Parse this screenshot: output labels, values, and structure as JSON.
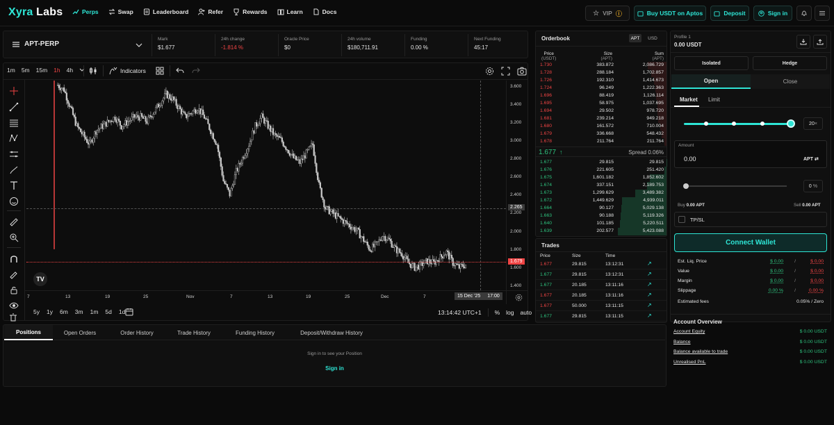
{
  "nav": {
    "logo_a": "Xyra",
    "logo_b": " Labs",
    "links": [
      "Perps",
      "Swap",
      "Leaderboard",
      "Refer",
      "Rewards",
      "Learn",
      "Docs"
    ],
    "vip": "VIP",
    "buy": "Buy USDT on Aptos",
    "deposit": "Deposit",
    "signin": "Sign in"
  },
  "market": {
    "symbol": "APT-PERP",
    "stats": [
      {
        "label": "Mark",
        "value": "$1.677"
      },
      {
        "label": "24h change",
        "value": "-1.814 %"
      },
      {
        "label": "Oracle Price",
        "value": "$0"
      },
      {
        "label": "24h volume",
        "value": "$180,711.91"
      },
      {
        "label": "Funding",
        "value": "0.00 %"
      },
      {
        "label": "Next Funding",
        "value": "45:17"
      }
    ]
  },
  "chart": {
    "timeframes": [
      "1m",
      "5m",
      "15m",
      "1h",
      "4h"
    ],
    "active_tf": "1h",
    "indicators": "Indicators",
    "y_ticks": [
      "3.600",
      "3.400",
      "3.200",
      "3.000",
      "2.800",
      "2.600",
      "2.400",
      "2.200",
      "2.000",
      "1.800",
      "1.600",
      "1.400"
    ],
    "x_ticks": [
      "7",
      "13",
      "19",
      "25",
      "Nov",
      "7",
      "13",
      "19",
      "25",
      "Dec",
      "7"
    ],
    "crosshair_price": "2.265",
    "last_price": "1.679",
    "crosshair_date": "15 Dec '25",
    "crosshair_time": "17:00",
    "ranges": [
      "5y",
      "1y",
      "6m",
      "3m",
      "1m",
      "5d",
      "1d"
    ],
    "clock": "13:14:42 UTC+1",
    "pct": "%",
    "log": "log",
    "auto": "auto",
    "chart_data": {
      "type": "candlestick",
      "x_range": [
        "Oct 7, 2025",
        "Dec 16, 2025"
      ],
      "ylim": [
        1.4,
        3.7
      ],
      "close_series": [
        3.65,
        3.6,
        3.4,
        3.2,
        3.1,
        3.0,
        3.15,
        3.2,
        3.25,
        3.3,
        3.2,
        3.25,
        3.3,
        3.3,
        3.25,
        3.35,
        3.45,
        3.55,
        3.5,
        3.4,
        3.3,
        3.35,
        3.4,
        3.3,
        3.15,
        3.0,
        2.6,
        2.45,
        2.7,
        2.85,
        3.0,
        3.2,
        3.3,
        3.2,
        3.1,
        3.05,
        2.95,
        2.85,
        2.8,
        2.9,
        3.0,
        2.55,
        2.3,
        2.25,
        2.2,
        2.15,
        2.1,
        2.05,
        1.95,
        1.85,
        1.9,
        2.0,
        1.95,
        1.85,
        1.8,
        1.7,
        1.65,
        1.68,
        1.72,
        1.7,
        1.76,
        1.82,
        1.7,
        1.65,
        1.68
      ]
    }
  },
  "orderbook": {
    "title": "Orderbook",
    "tab_a": "APT",
    "tab_b": "USD",
    "h_price": "Price",
    "h_price_u": "(USDT)",
    "h_size": "Size",
    "h_size_u": "(APT)",
    "h_sum": "Sum",
    "h_sum_u": "(APT)",
    "asks": [
      [
        "1.730",
        "383.872",
        "2,086.729"
      ],
      [
        "1.728",
        "288.184",
        "1,702.857"
      ],
      [
        "1.726",
        "192.310",
        "1,414.673"
      ],
      [
        "1.724",
        "96.249",
        "1,222.363"
      ],
      [
        "1.696",
        "88.419",
        "1,126.114"
      ],
      [
        "1.695",
        "58.975",
        "1,037.695"
      ],
      [
        "1.694",
        "29.502",
        "978.720"
      ],
      [
        "1.681",
        "239.214",
        "949.218"
      ],
      [
        "1.680",
        "161.572",
        "710.004"
      ],
      [
        "1.679",
        "336.668",
        "548.432"
      ],
      [
        "1.678",
        "211.764",
        "211.764"
      ]
    ],
    "mid_price": "1.677",
    "spread": "Spread 0.06%",
    "bids": [
      [
        "1.677",
        "29.815",
        "29.815"
      ],
      [
        "1.676",
        "221.605",
        "251.420"
      ],
      [
        "1.675",
        "1,601.182",
        "1,852.602"
      ],
      [
        "1.674",
        "337.151",
        "2,189.753"
      ],
      [
        "1.673",
        "1,299.629",
        "3,489.382"
      ],
      [
        "1.672",
        "1,449.629",
        "4,939.011"
      ],
      [
        "1.664",
        "90.127",
        "5,029.138"
      ],
      [
        "1.663",
        "90.188",
        "5,119.326"
      ],
      [
        "1.640",
        "101.185",
        "5,220.511"
      ],
      [
        "1.639",
        "202.577",
        "5,423.088"
      ]
    ]
  },
  "trades": {
    "title": "Trades",
    "h_price": "Price",
    "h_size": "Size",
    "h_time": "Time",
    "rows": [
      [
        "1.677",
        "29.815",
        "13:12:31",
        "red"
      ],
      [
        "1.677",
        "29.815",
        "13:12:31",
        "green"
      ],
      [
        "1.677",
        "20.185",
        "13:11:16",
        "green"
      ],
      [
        "1.677",
        "20.185",
        "13:11:16",
        "red"
      ],
      [
        "1.677",
        "50.000",
        "13:11:15",
        "red"
      ],
      [
        "1.677",
        "29.815",
        "13:11:15",
        "green"
      ]
    ]
  },
  "positions": {
    "tabs": [
      "Positions",
      "Open Orders",
      "Order History",
      "Trade History",
      "Funding History",
      "Deposit/Withdraw History"
    ],
    "empty": "Sign in to see your Position",
    "signin": "Sign in"
  },
  "order": {
    "profile": "Profile 1",
    "balance": "0.00 USDT",
    "isolated": "Isolated",
    "hedge": "Hedge",
    "open": "Open",
    "close": "Close",
    "market": "Market",
    "limit": "Limit",
    "leverage": "20",
    "leverage_unit": "×",
    "amount_label": "Amount",
    "amount_value": "0.00",
    "amount_unit": "APT",
    "pct_value": "0",
    "pct_unit": "%",
    "buy_label": "Buy",
    "buy_val": "0.00 APT",
    "sell_label": "Sell",
    "sell_val": "0.00 APT",
    "tpsl": "TP/SL",
    "connect": "Connect Wallet",
    "metrics": [
      {
        "label": "Est. Liq. Price",
        "g": "$ 0.00",
        "r": "$ 0.00"
      },
      {
        "label": "Value",
        "g": "$ 0.00",
        "r": "$ 0.00"
      },
      {
        "label": "Margin",
        "g": "$ 0.00",
        "r": "$ 0.00"
      },
      {
        "label": "Slippage",
        "g": "0.00 %",
        "r": "0.00 %"
      }
    ],
    "fees_label": "Estimated fees",
    "fees_val": "0.05% / Zero",
    "overview": "Account Overview",
    "account": [
      {
        "label": "Account Equity",
        "value": "$ 0.00 USDT"
      },
      {
        "label": "Balance",
        "value": "$ 0.00 USDT"
      },
      {
        "label": "Balance available to trade",
        "value": "$ 0.00 USDT"
      },
      {
        "label": "Unrealised PnL",
        "value": "$ 0.00 USDT"
      }
    ]
  }
}
